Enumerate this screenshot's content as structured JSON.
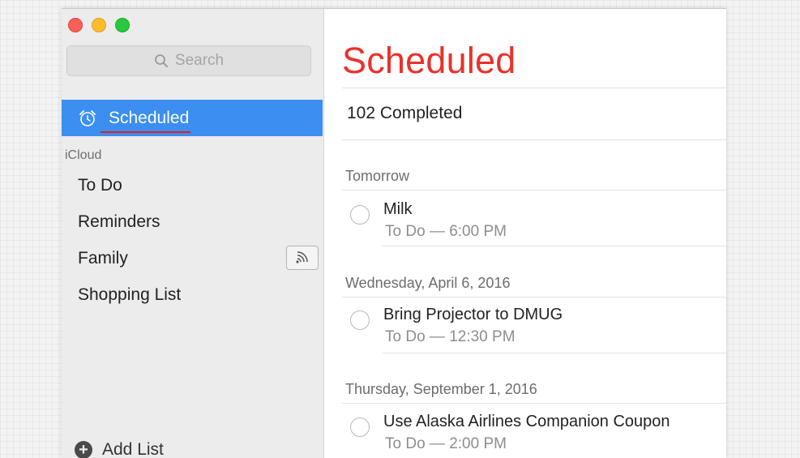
{
  "sidebar": {
    "search": {
      "placeholder": "Search",
      "icon": "magnifying-glass-icon"
    },
    "selected": {
      "label": "Scheduled",
      "icon": "alarm-clock-icon"
    },
    "group_title": "iCloud",
    "lists": [
      {
        "label": "To Do"
      },
      {
        "label": "Reminders"
      },
      {
        "label": "Family",
        "shared_icon": "shared-list-icon"
      },
      {
        "label": "Shopping List"
      }
    ],
    "add_list_label": "Add List"
  },
  "main": {
    "title": "Scheduled",
    "completed": "102 Completed",
    "sections": [
      {
        "header": "Tomorrow",
        "tasks": [
          {
            "title": "Milk",
            "subtitle": "To Do — 6:00 PM"
          }
        ]
      },
      {
        "header": "Wednesday, April 6, 2016",
        "tasks": [
          {
            "title": "Bring Projector to DMUG",
            "subtitle": "To Do — 12:30 PM"
          }
        ]
      },
      {
        "header": "Thursday, September 1, 2016",
        "tasks": [
          {
            "title": "Use Alaska Airlines Companion Coupon",
            "subtitle": "To Do — 2:00 PM"
          }
        ]
      }
    ]
  },
  "colors": {
    "accent_title": "#e8322c",
    "selection": "#3c8ef0",
    "underline": "#e02020"
  }
}
